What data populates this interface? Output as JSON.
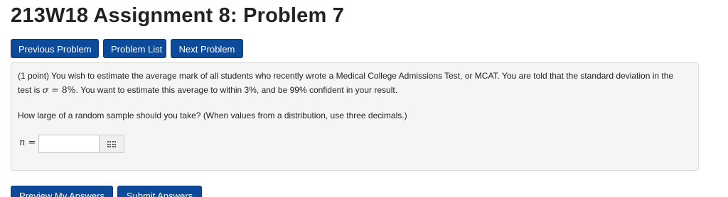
{
  "page": {
    "title": "213W18 Assignment 8: Problem 7"
  },
  "nav": {
    "previous_label": "Previous Problem",
    "list_label": "Problem List",
    "next_label": "Next Problem"
  },
  "problem": {
    "points": "(1 point)",
    "text_before_sigma": "You wish to estimate the average mark of all students who recently wrote a Medical College Admissions Test, or MCAT. You are told that the standard deviation in the test is",
    "sigma_symbol": "σ",
    "sigma_equals": "=",
    "sigma_value": "8%",
    "text_after_sigma": ". You want to estimate this average to within 3%, and be 99% confident in your result.",
    "question": "How large of a random sample should you take? (When values from a distribution, use three decimals.)",
    "answer_variable": "n",
    "answer_equals": "=",
    "answer_value": ""
  },
  "icons": {
    "palette": "equation-palette-grid-icon"
  },
  "actions": {
    "preview_label": "Preview My Answers",
    "submit_label": "Submit Answers"
  }
}
